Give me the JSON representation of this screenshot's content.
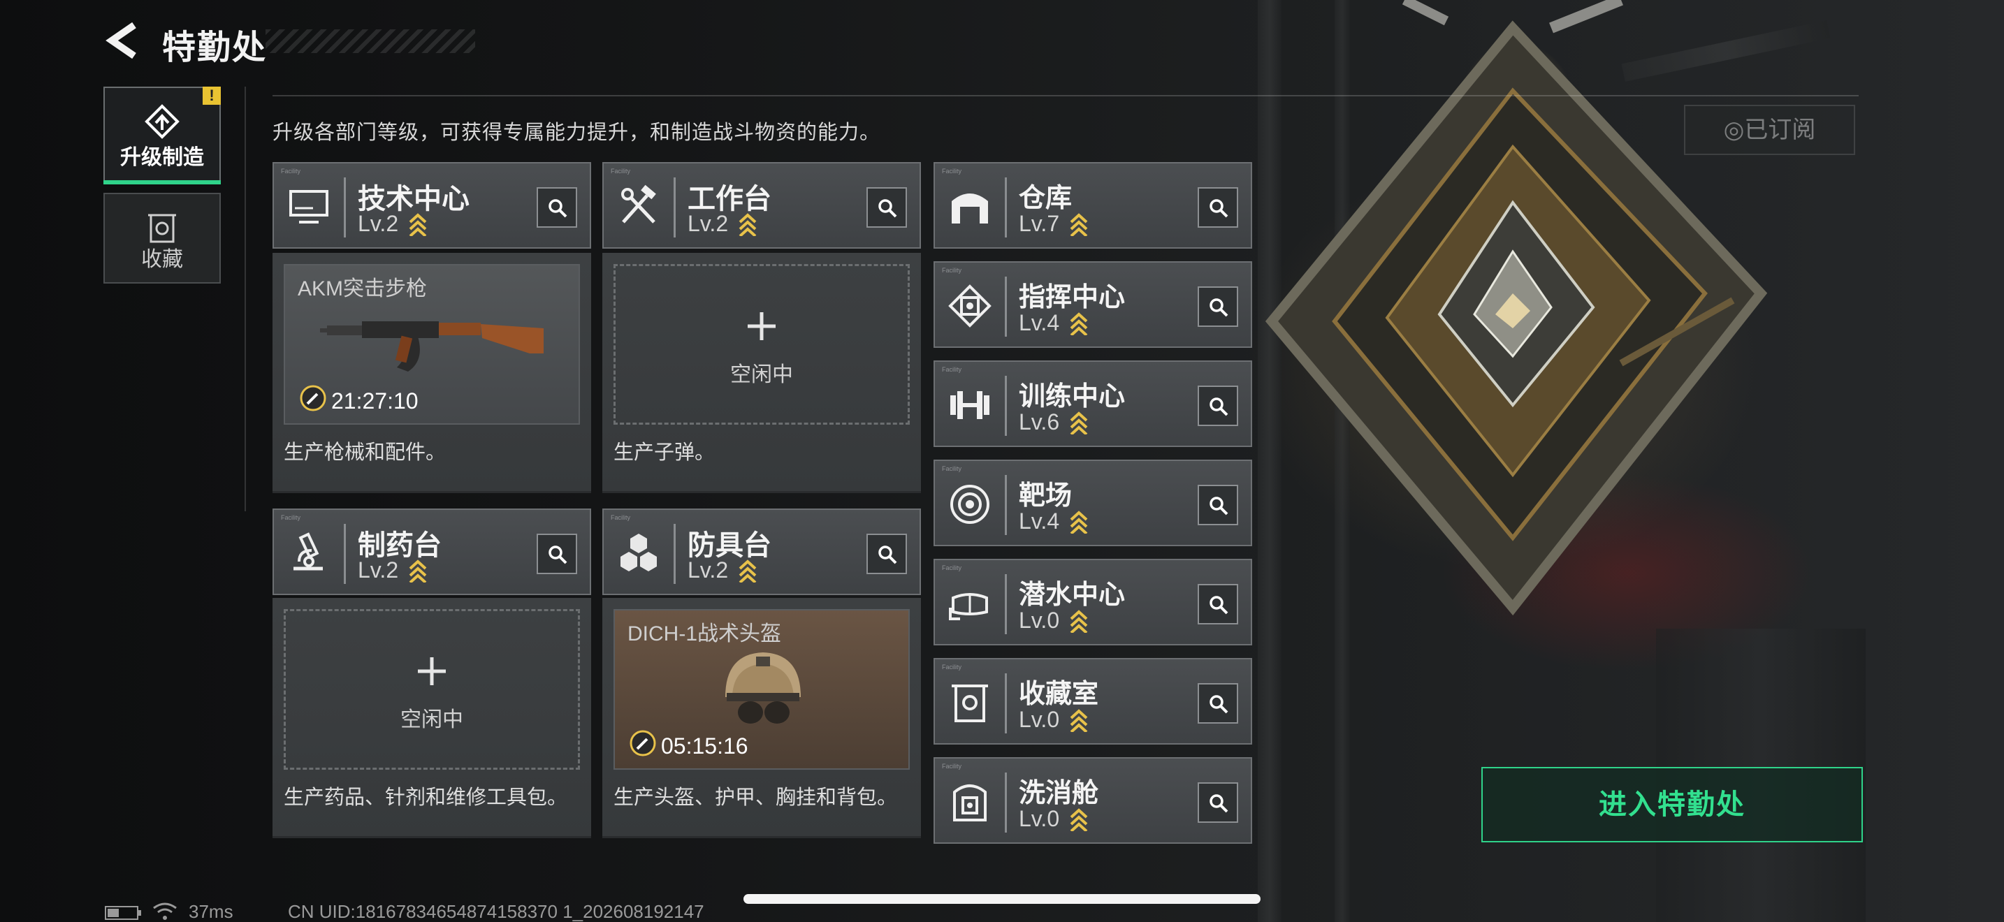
{
  "header": {
    "title": "特勤处",
    "back_icon": "back-arrow-icon"
  },
  "nav": [
    {
      "label": "升级制造",
      "icon": "upgrade-build-icon",
      "active": true,
      "badge": "!"
    },
    {
      "label": "收藏",
      "icon": "collection-icon",
      "active": false
    }
  ],
  "description": "升级各部门等级，可获得专属能力提升，和制造战斗物资的能力。",
  "subscribed_label": "已订阅",
  "facilities": {
    "tech": {
      "name": "技术中心",
      "level": "Lv.2",
      "icon": "monitor-icon"
    },
    "workbench": {
      "name": "工作台",
      "level": "Lv.2",
      "icon": "tools-icon"
    },
    "pharmacy": {
      "name": "制药台",
      "level": "Lv.2",
      "icon": "microscope-icon"
    },
    "armor": {
      "name": "防具台",
      "level": "Lv.2",
      "icon": "hexagons-icon"
    },
    "warehouse": {
      "name": "仓库",
      "level": "Lv.7",
      "icon": "warehouse-icon"
    },
    "command": {
      "name": "指挥中心",
      "level": "Lv.4",
      "icon": "chip-icon"
    },
    "training": {
      "name": "训练中心",
      "level": "Lv.6",
      "icon": "dumbbell-icon"
    },
    "range": {
      "name": "靶场",
      "level": "Lv.4",
      "icon": "target-icon"
    },
    "diving": {
      "name": "潜水中心",
      "level": "Lv.0",
      "icon": "diving-mask-icon"
    },
    "collection_room": {
      "name": "收藏室",
      "level": "Lv.0",
      "icon": "vault-icon"
    },
    "decon": {
      "name": "洗消舱",
      "level": "Lv.0",
      "icon": "decon-chamber-icon"
    }
  },
  "production": {
    "tech": {
      "item": "AKM突击步枪",
      "timer": "21:27:10",
      "desc": "生产枪械和配件。",
      "status": "busy"
    },
    "workbench": {
      "idle_label": "空闲中",
      "desc": "生产子弹。",
      "status": "idle"
    },
    "pharmacy": {
      "idle_label": "空闲中",
      "desc": "生产药品、针剂和维修工具包。",
      "status": "idle"
    },
    "armor": {
      "item": "DICH-1战术头盔",
      "timer": "05:15:16",
      "desc": "生产头盔、护甲、胸挂和背包。",
      "status": "busy"
    }
  },
  "enter_button": "进入特勤处",
  "status_bar": {
    "ping": "37ms",
    "uid": "CN UID:18167834654874158370 1_202608192147"
  },
  "colors": {
    "accent_green": "#2fd38a",
    "level_chevron": "#e8c24a",
    "badge_yellow": "#e9c332"
  }
}
